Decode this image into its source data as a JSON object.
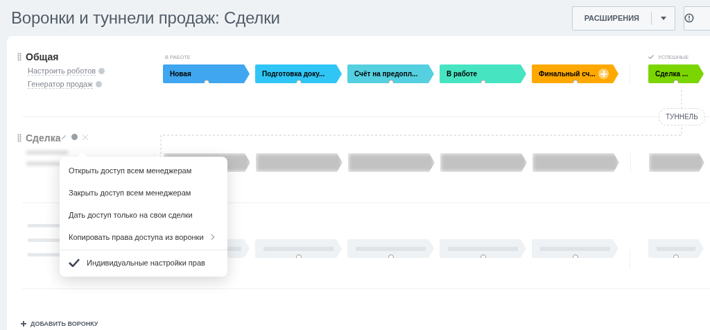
{
  "page": {
    "title": "Воронки и туннели продаж: Сделки"
  },
  "toolbar": {
    "extensions_button": "РАСШИРЕНИЯ"
  },
  "funnel": {
    "name": "Общая",
    "links": [
      "Настроить роботов",
      "Генератор продаж"
    ],
    "groups": [
      {
        "label": "В РАБОТЕ",
        "kind": "progress",
        "stages": [
          {
            "name": "Новая",
            "color": "#3fa6ef",
            "add_button": false
          },
          {
            "name": "Подготовка доку...",
            "color": "#2fc6f6",
            "add_button": false
          },
          {
            "name": "Счёт на предопл...",
            "color": "#55d0e0",
            "add_button": false
          },
          {
            "name": "В работе",
            "color": "#47e4c2",
            "add_button": false
          },
          {
            "name": "Финальный сч...",
            "color": "#ffa900",
            "add_button": true
          }
        ]
      },
      {
        "label": "УСПЕШНЫЕ",
        "kind": "success",
        "stages": [
          {
            "name": "Сделка ...",
            "color": "#7bd500",
            "add_button": false
          }
        ]
      }
    ]
  },
  "second_funnel": {
    "name": "Сделка"
  },
  "tunnel_badge": "ТУННЕЛЬ",
  "context_menu": {
    "items": [
      {
        "label": "Открыть доступ всем менеджерам",
        "kind": "action"
      },
      {
        "label": "Закрыть доступ всем менеджерам",
        "kind": "action"
      },
      {
        "label": "Дать доступ только на свои сделки",
        "kind": "action"
      },
      {
        "label": "Копировать права доступа из воронки",
        "kind": "submenu"
      },
      {
        "label": "Индивидуальные настройки прав",
        "kind": "check",
        "checked": true
      }
    ]
  },
  "add_funnel": "ДОБАВИТЬ ВОРОНКУ"
}
